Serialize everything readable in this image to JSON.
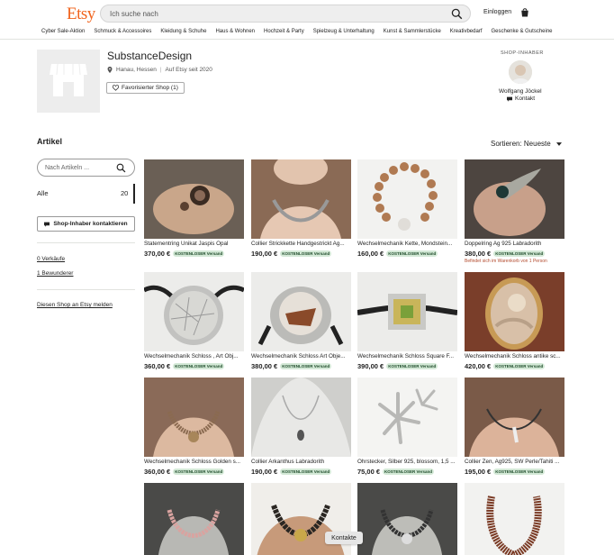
{
  "header": {
    "logo": "Etsy",
    "search_placeholder": "Ich suche nach",
    "login": "Einloggen",
    "categories": [
      "Cyber Sale-Aktion",
      "Schmuck & Accessoires",
      "Kleidung & Schuhe",
      "Haus & Wohnen",
      "Hochzeit & Party",
      "Spielzeug & Unterhaltung",
      "Kunst & Sammlerstücke",
      "Kreativbedarf",
      "Geschenke & Gutscheine"
    ]
  },
  "shop": {
    "name": "SubstanceDesign",
    "location": "Hanau, Hessen",
    "since": "Auf Etsy seit 2020",
    "favorite_label": "Favorisierter Shop (1)",
    "owner_label": "SHOP-INHABER",
    "owner_name": "Wolfgang Jöckel",
    "owner_contact": "Kontakt"
  },
  "section": {
    "title": "Artikel",
    "sort_label": "Sortieren: Neueste"
  },
  "sidebar": {
    "search_placeholder": "Nach Artikeln ...",
    "all_label": "Alle",
    "all_count": "20",
    "contact_button": "Shop-Inhaber kontaktieren",
    "sales": "0 Verkäufe",
    "admirers": "1 Bewunderer",
    "report": "Diesen Shop an Etsy melden"
  },
  "badge_label": "KOSTENLOSER Versand",
  "listings": [
    {
      "title": "Statementring Unikat Jaspis Opal",
      "price": "370,00 €",
      "badge": true,
      "note": ""
    },
    {
      "title": "Collier Strickkette Handgestrickt Ag...",
      "price": "190,00 €",
      "badge": true,
      "note": ""
    },
    {
      "title": "Wechselmechanik Kette, Mondstein...",
      "price": "160,00 €",
      "badge": true,
      "note": ""
    },
    {
      "title": "Doppelring Ag 925 Labradorith",
      "price": "380,00 €",
      "badge": true,
      "note": "Befindet sich im Warenkorb von 1 Person"
    },
    {
      "title": "Wechselmechanik Schloss , Art Obj...",
      "price": "360,00 €",
      "badge": true,
      "note": ""
    },
    {
      "title": "Wechselmechanik Schloss Art Obje...",
      "price": "380,00 €",
      "badge": true,
      "note": ""
    },
    {
      "title": "Wechselmechanik Schloss Square F...",
      "price": "390,00 €",
      "badge": true,
      "note": ""
    },
    {
      "title": "Wechselmechanik Schloss antike sc...",
      "price": "420,00 €",
      "badge": true,
      "note": ""
    },
    {
      "title": "Wechselmechanik Schloss Golden s...",
      "price": "360,00 €",
      "badge": true,
      "note": ""
    },
    {
      "title": "Collier Arkanthus Labradorith",
      "price": "190,00 €",
      "badge": true,
      "note": ""
    },
    {
      "title": "Ohrstecker, Silber 925, blossom, 1,5 ...",
      "price": "75,00 €",
      "badge": true,
      "note": ""
    },
    {
      "title": "Collier Zen, Ag925, SW Perle/Tahiti ...",
      "price": "195,00 €",
      "badge": true,
      "note": ""
    },
    {
      "title": "",
      "price": "",
      "badge": false,
      "note": ""
    },
    {
      "title": "",
      "price": "",
      "badge": false,
      "note": ""
    },
    {
      "title": "",
      "price": "",
      "badge": false,
      "note": ""
    },
    {
      "title": "",
      "price": "",
      "badge": false,
      "note": ""
    }
  ],
  "kontakte": "Kontakte",
  "colors": {
    "brand": "#f1641e",
    "badge_bg": "#d4e9d7",
    "badge_text": "#1e4b2a",
    "note": "#b34b2e"
  }
}
